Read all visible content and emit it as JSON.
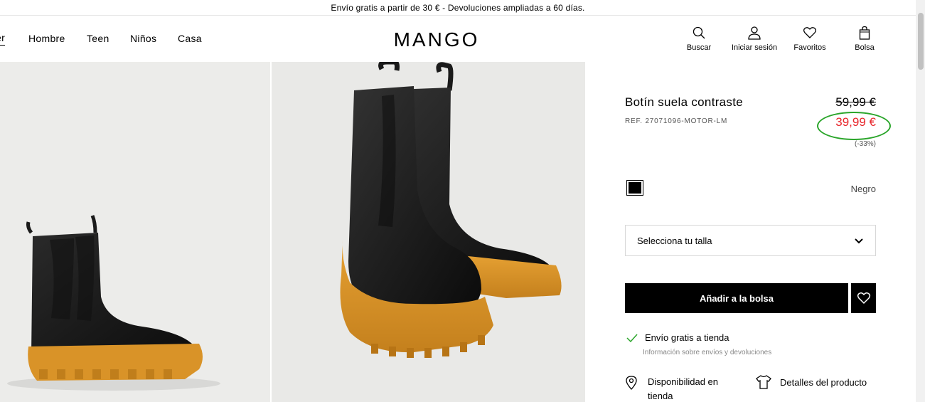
{
  "announcement": "Envío gratis a partir de 30 € - Devoluciones ampliadas a 60 días.",
  "nav": {
    "items": [
      "er",
      "Hombre",
      "Teen",
      "Niños",
      "Casa"
    ]
  },
  "logo": "MANGO",
  "header_icons": {
    "search": "Buscar",
    "login": "Iniciar sesión",
    "favorites": "Favoritos",
    "bag": "Bolsa"
  },
  "product": {
    "name": "Botín suela contraste",
    "ref": "REF. 27071096-MOTOR-LM",
    "old_price": "59,99 €",
    "new_price": "39,99 €",
    "discount": "(-33%)",
    "color_name": "Negro",
    "size_placeholder": "Selecciona tu talla",
    "add_to_bag": "Añadir a la bolsa",
    "shipping": "Envío gratis a tienda",
    "shipping_info": "Información sobre envíos y devoluciones",
    "availability_line1": "Disponibilidad en",
    "availability_line2": "tienda",
    "details": "Detalles del producto"
  },
  "colors": {
    "sale": "#e8262b",
    "highlight_circle": "#2aa52a",
    "check": "#2aa52a"
  }
}
